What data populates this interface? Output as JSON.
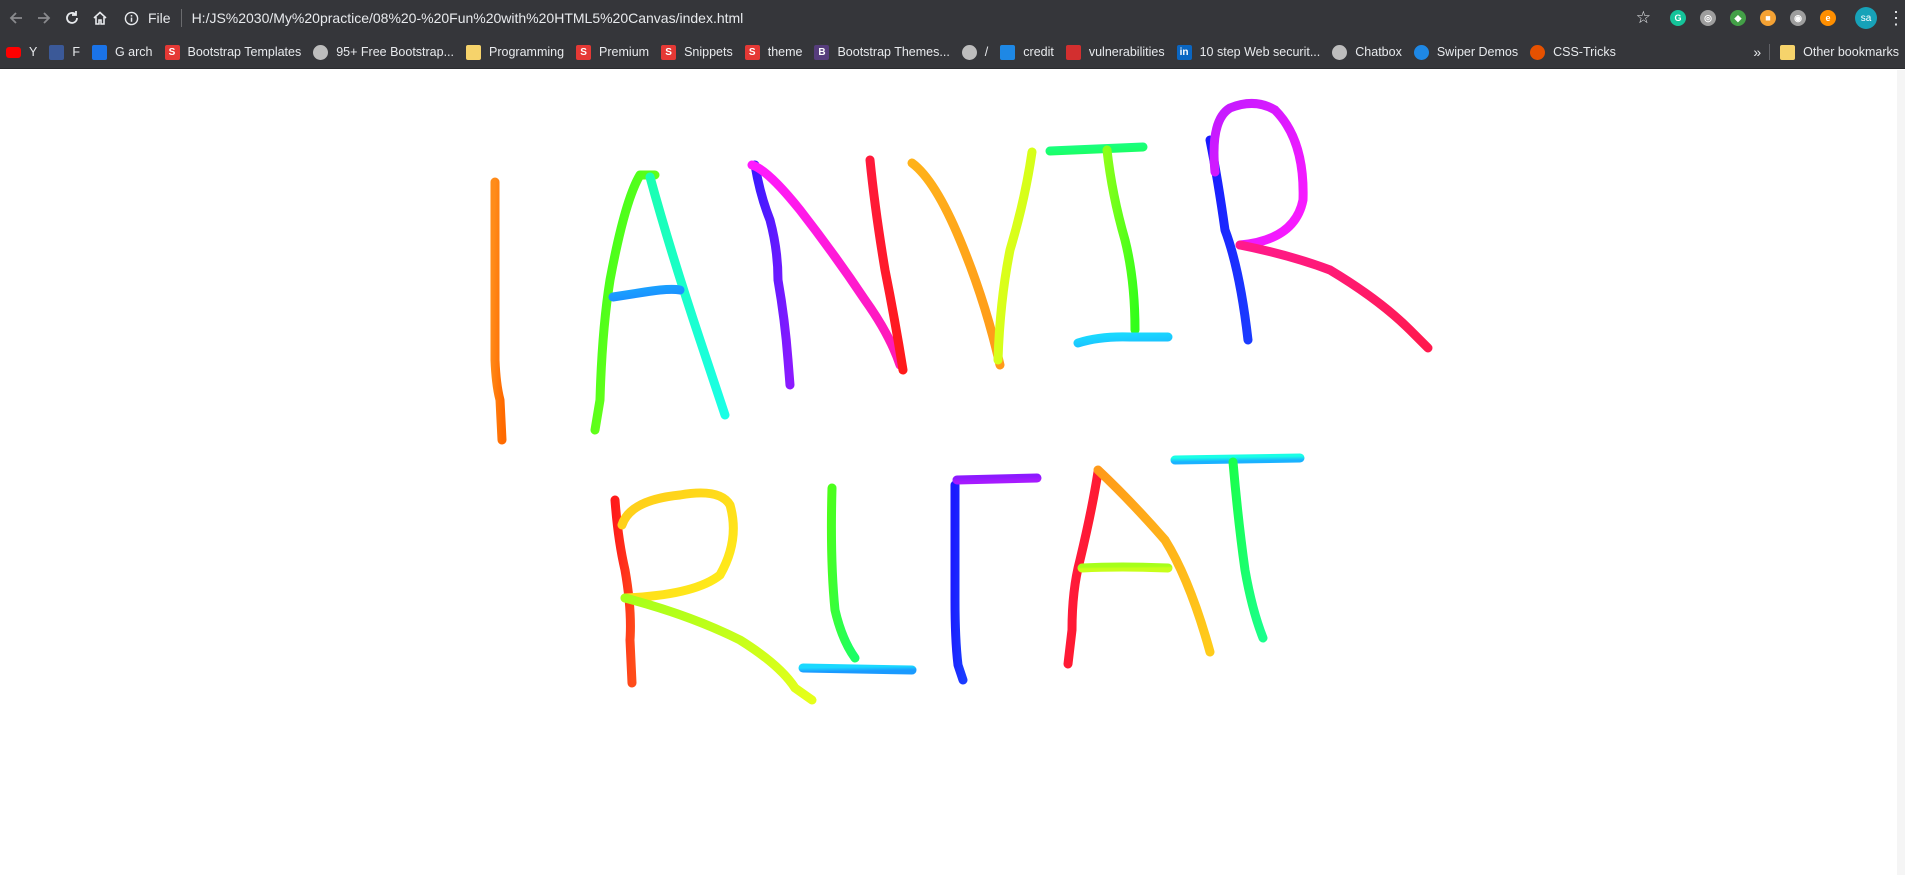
{
  "toolbar": {
    "file_label": "File",
    "url": "H:/JS%2030/My%20practice/08%20-%20Fun%20with%20HTML5%20Canvas/index.html",
    "avatar_initials": "sa"
  },
  "bookmarks": [
    {
      "label": "Y",
      "icon": "youtube-icon",
      "color": "#ff0000"
    },
    {
      "label": "F",
      "icon": "facebook-icon",
      "color": "#3b5998"
    },
    {
      "label": "G arch",
      "icon": "search-icon",
      "color": "#1a73e8"
    },
    {
      "label": "Bootstrap Templates",
      "icon": "s-logo-icon",
      "color": "#e53935"
    },
    {
      "label": "95+ Free Bootstrap...",
      "icon": "globe-icon",
      "color": "#bdbdbd"
    },
    {
      "label": "Programming",
      "icon": "folder-icon",
      "color": "#f6d36b"
    },
    {
      "label": "Premium",
      "icon": "s-logo-icon",
      "color": "#e53935"
    },
    {
      "label": "Snippets",
      "icon": "s-logo-icon",
      "color": "#e53935"
    },
    {
      "label": "theme",
      "icon": "s-logo-icon",
      "color": "#e53935"
    },
    {
      "label": "Bootstrap Themes...",
      "icon": "bootstrap-icon",
      "color": "#563d7c"
    },
    {
      "label": "/",
      "icon": "globe-icon",
      "color": "#bdbdbd"
    },
    {
      "label": "credit",
      "icon": "leaf-icon",
      "color": "#1e88e5"
    },
    {
      "label": "vulnerabilities",
      "icon": "k-logo-icon",
      "color": "#d32f2f"
    },
    {
      "label": "10 step Web securit...",
      "icon": "linkedin-icon",
      "color": "#0a66c2"
    },
    {
      "label": "Chatbox",
      "icon": "globe-icon",
      "color": "#bdbdbd"
    },
    {
      "label": "Swiper Demos",
      "icon": "s-circle-icon",
      "color": "#1e88e5"
    },
    {
      "label": "CSS-Tricks",
      "icon": "star-logo-icon",
      "color": "#e65100"
    }
  ],
  "bookmarks_other": "Other bookmarks",
  "extensions": [
    {
      "icon": "grammarly-icon",
      "color": "#15c39a",
      "glyph": "G"
    },
    {
      "icon": "extension-gray-icon",
      "color": "#9e9e9e",
      "glyph": "◎"
    },
    {
      "icon": "extension-green-icon",
      "color": "#43a047",
      "glyph": "◆"
    },
    {
      "icon": "extension-orange-icon",
      "color": "#f4a234",
      "glyph": "■"
    },
    {
      "icon": "camera-icon",
      "color": "#9e9e9e",
      "glyph": "◉"
    },
    {
      "icon": "extension-ext-icon",
      "color": "#ff8f00",
      "glyph": "e"
    }
  ],
  "drawing": {
    "text": "TANVIR RIFAT"
  }
}
